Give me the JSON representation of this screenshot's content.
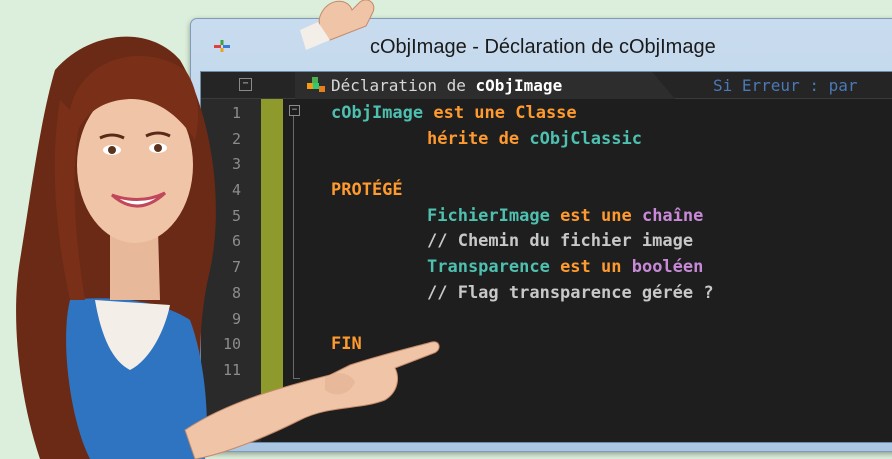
{
  "window": {
    "title": "cObjImage - Déclaration de cObjImage"
  },
  "tabs": {
    "active_prefix": "Déclaration de ",
    "active_name": "cObjImage",
    "inactive_label": "Si Erreur : par"
  },
  "line_numbers": [
    "1",
    "2",
    "3",
    "4",
    "5",
    "6",
    "7",
    "8",
    "9",
    "10",
    "11"
  ],
  "code": {
    "l1_class": "cObjImage",
    "l1_kw": " est une Classe",
    "l2_kw": "hérite de ",
    "l2_parent": "cObjClassic",
    "l4_kw": "PROTÉGÉ",
    "l5_member": "FichierImage",
    "l5_kw": " est une ",
    "l5_type": "chaîne",
    "l6_comment": "// Chemin du fichier image",
    "l7_member": "Transparence",
    "l7_kw": " est un ",
    "l7_type": "booléen",
    "l8_comment": "// Flag transparence gérée ?",
    "l10_kw": "FIN"
  },
  "colors": {
    "identifier": "#4dc0b0",
    "keyword": "#ff9a2e",
    "type": "#c88ad8",
    "comment": "#c8c8c8",
    "change_bar": "#8f9a2d"
  },
  "icons": {
    "app": "windev-app-icon",
    "tab": "class-declaration-icon"
  }
}
